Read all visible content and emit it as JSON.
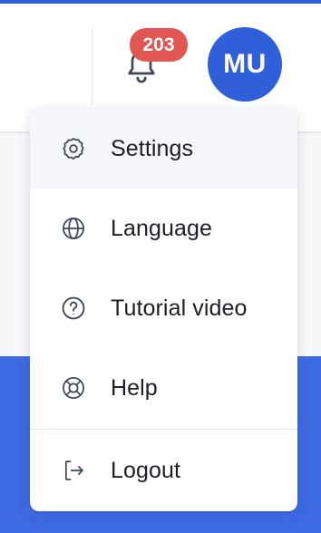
{
  "header": {
    "notification_count": "203",
    "avatar_initials": "MU"
  },
  "colors": {
    "brand": "#2f5fd9",
    "badge": "#e05652",
    "panel_blue": "#3e6be3",
    "icon_stroke": "#3f4657"
  },
  "menu": {
    "items": [
      {
        "label": "Settings",
        "icon": "gear-icon",
        "active": true
      },
      {
        "label": "Language",
        "icon": "globe-icon",
        "active": false
      },
      {
        "label": "Tutorial video",
        "icon": "question-circle-icon",
        "active": false
      },
      {
        "label": "Help",
        "icon": "lifebuoy-icon",
        "active": false
      },
      {
        "label": "Logout",
        "icon": "logout-icon",
        "active": false
      }
    ]
  }
}
